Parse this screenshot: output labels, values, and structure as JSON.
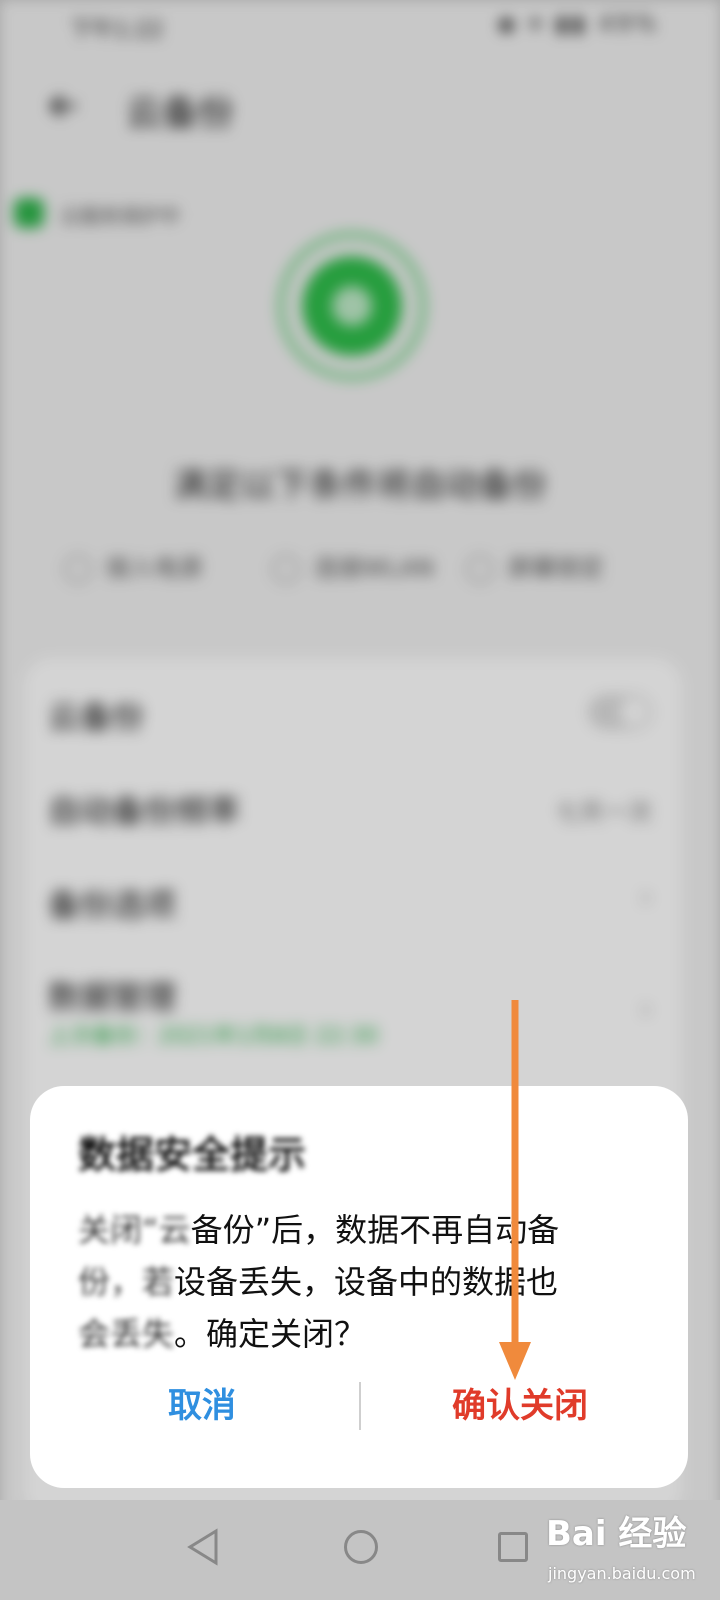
{
  "status_bar": {
    "time": "下午1:22",
    "icons": "◆ ▾ ▮▮ 49%"
  },
  "header": {
    "title": "云备份"
  },
  "protect_badge": {
    "text": "云服务保护中"
  },
  "headline": "满足以下条件将自动备份",
  "conditions": [
    {
      "label": "接入电源"
    },
    {
      "label": "连接WLAN"
    },
    {
      "label": "屏幕锁定"
    }
  ],
  "settings": [
    {
      "label": "云备份",
      "value": ""
    },
    {
      "label": "自动备份频率",
      "value": "七天一次"
    },
    {
      "label": "备份选项",
      "value": ""
    },
    {
      "label": "数据管理",
      "value": ""
    }
  ],
  "last_backup": "上次备份：2021年1月8日 22:30",
  "dialog": {
    "title": "数据安全提示",
    "body_blurred_1": "关闭“云",
    "body_clear_1": "备份”后，数据不再自动备",
    "body_blurred_2": "份，若",
    "body_clear_2": "设备丢失，设备中的数据也",
    "body_blurred_3": "会丢失",
    "body_clear_3": "。确定关闭？",
    "cancel_label": "取消",
    "confirm_label": "确认关闭"
  },
  "colors": {
    "cancel": "#2f8fe0",
    "confirm": "#e03b2a",
    "accent_green": "#2db34a",
    "annotation_arrow": "#f08a3c"
  },
  "watermark": {
    "logo": "Bai 经验",
    "url": "jingyan.baidu.com"
  }
}
